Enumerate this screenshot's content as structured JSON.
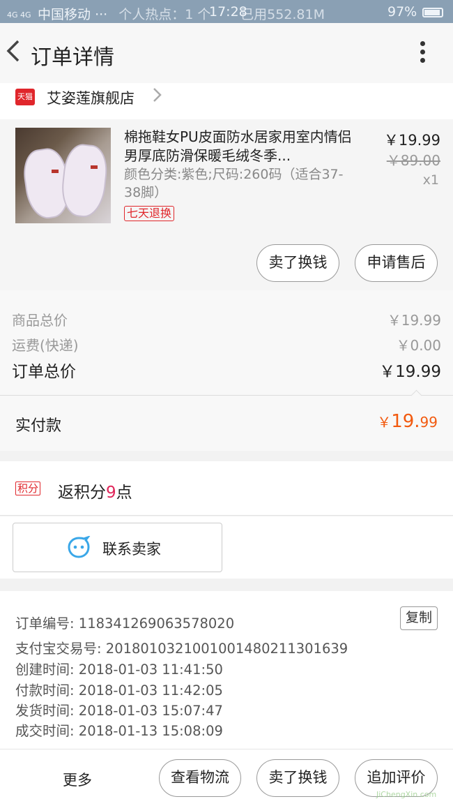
{
  "status_bar": {
    "signal": "4G 4G",
    "carrier": "中国移动 ···",
    "hotspot": "个人热点：1 个",
    "time": "17:28",
    "data_used": "已用552.81M",
    "battery": "97%"
  },
  "nav": {
    "title": "订单详情"
  },
  "store": {
    "badge": "天猫",
    "name": "艾姿莲旗舰店"
  },
  "product": {
    "name": "棉拖鞋女PU皮面防水居家用室内情侣男厚底防滑保暖毛绒冬季...",
    "sku": "颜色分类:紫色;尺码:260码（适合37-38脚）",
    "badge": "七天退换",
    "price": "￥19.99",
    "original_price": "￥89.00",
    "quantity": "x1",
    "button_sell": "卖了换钱",
    "button_aftersale": "申请售后"
  },
  "summary": {
    "goods_label": "商品总价",
    "goods_value": "￥19.99",
    "shipping_label": "运费(快递)",
    "shipping_value": "￥0.00",
    "total_label": "订单总价",
    "total_value": "￥19.99",
    "paid_label": "实付款",
    "paid_currency": "￥",
    "paid_int": "19.",
    "paid_dec": "99"
  },
  "points": {
    "badge": "积分",
    "prefix": "返积分",
    "value": "9",
    "suffix": "点"
  },
  "contact": {
    "label": "联系卖家"
  },
  "order_info": {
    "order_no_label": "订单编号:",
    "order_no": "118341269063578020",
    "copy_label": "复制",
    "alipay_label": "支付宝交易号:",
    "alipay_no": "2018010321001001480211301639",
    "created_label": "创建时间:",
    "created": "2018-01-03 11:41:50",
    "paid_label": "付款时间:",
    "paid": "2018-01-03 11:42:05",
    "shipped_label": "发货时间:",
    "shipped": "2018-01-03 15:07:47",
    "completed_label": "成交时间:",
    "completed": "2018-01-13 15:08:09"
  },
  "bottom_bar": {
    "more": "更多",
    "logistics": "查看物流",
    "sell": "卖了换钱",
    "review": "追加评价"
  },
  "watermark": "JiChengXin.com",
  "colors": {
    "accent": "#e0262b",
    "price_orange": "#f25a0f",
    "points": "#e0265a",
    "icon_blue": "#3aa7e8"
  }
}
